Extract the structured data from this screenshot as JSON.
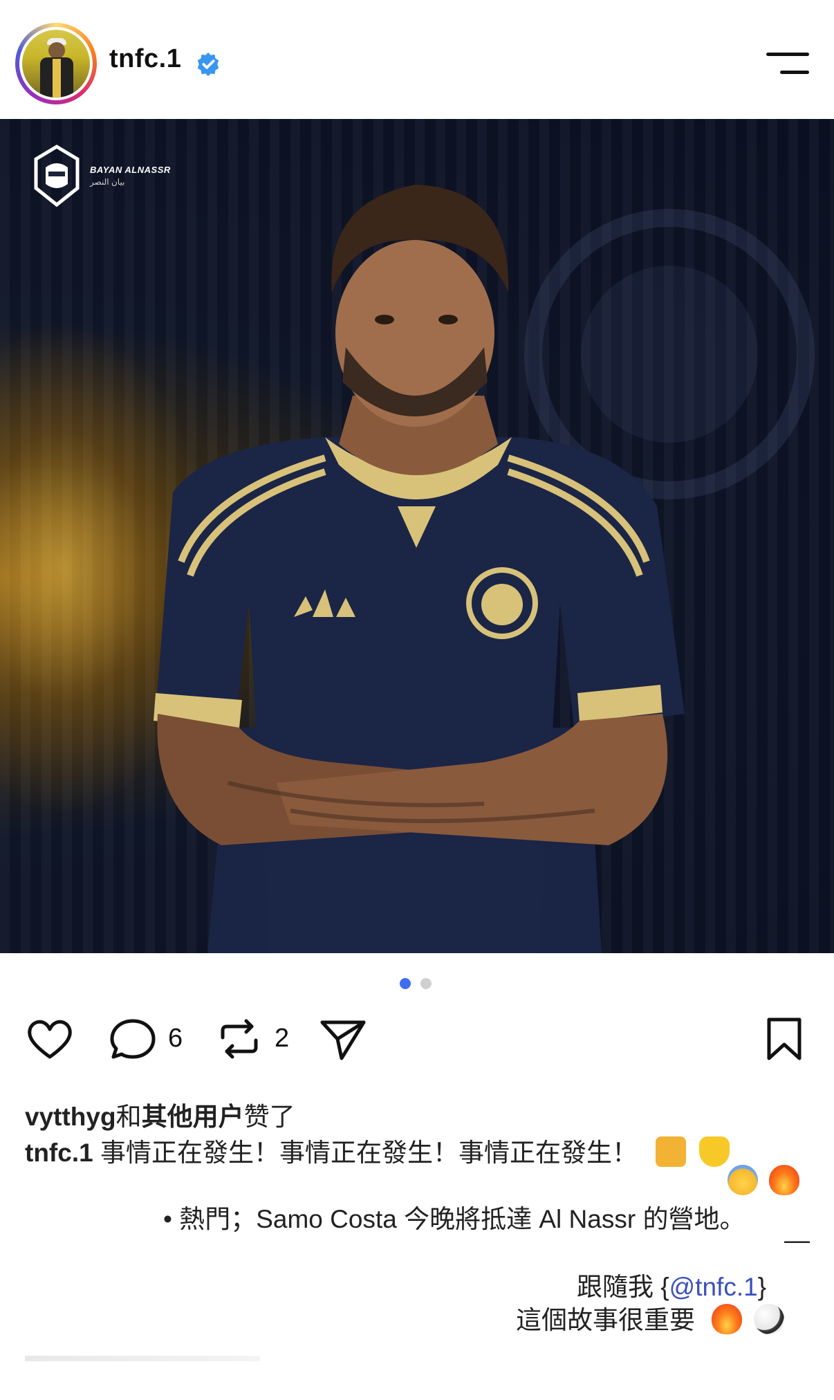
{
  "header": {
    "username": "tnfc.1",
    "verified_icon": "verified-badge-icon",
    "menu_icon": "menu-icon"
  },
  "post": {
    "image_brand_text": "BAYAN ALNASSR",
    "image_brand_sub": "بيان النصر",
    "carousel": {
      "current": 1,
      "total": 2,
      "active_color": "#3f6df2"
    }
  },
  "actions": {
    "like_icon": "heart-icon",
    "comment_icon": "comment-icon",
    "comment_count": "6",
    "repost_icon": "repost-icon",
    "repost_count": "2",
    "share_icon": "send-icon",
    "save_icon": "bookmark-icon"
  },
  "likes": {
    "user": "vytthyg",
    "joiner": "和",
    "others": "其他用户",
    "suffix": "赞了"
  },
  "caption": {
    "user": "tnfc.1",
    "line1": "事情正在發生！事情正在發生！事情正在發生！",
    "line3": "• 熱門；Samo Costa 今晚將抵達 Al Nassr 的營地。",
    "dash": "—",
    "follow_prefix": "跟隨我 {",
    "follow_mention": "@tnfc.1",
    "follow_suffix": "}",
    "line6": "這個故事很重要"
  }
}
